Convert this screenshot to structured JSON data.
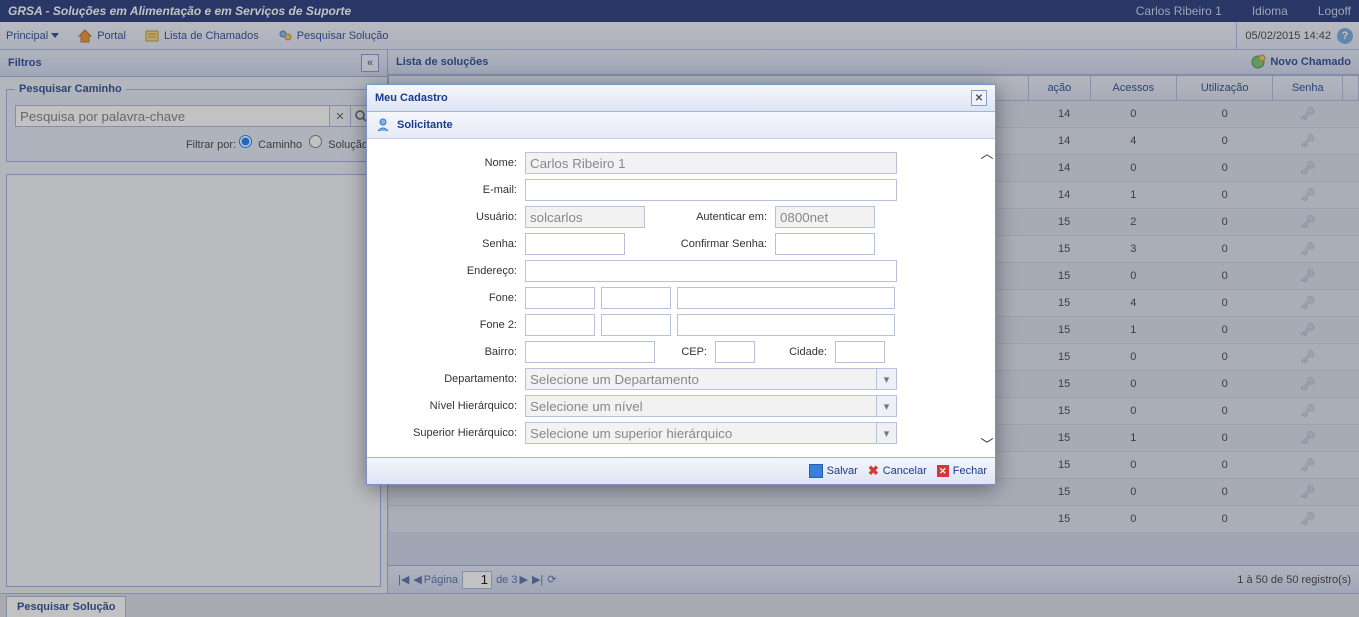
{
  "topbar": {
    "title": "GRSA - Soluções em Alimentação e em Serviços de Suporte",
    "user": "Carlos Ribeiro 1",
    "lang": "Idioma",
    "logoff": "Logoff"
  },
  "toolbar": {
    "principal": "Principal",
    "portal": "Portal",
    "lista": "Lista de Chamados",
    "pesquisar": "Pesquisar Solução",
    "datetime": "05/02/2015 14:42"
  },
  "left": {
    "title": "Filtros",
    "fieldset_title": "Pesquisar Caminho",
    "search_placeholder": "Pesquisa por palavra-chave",
    "filter_label": "Filtrar por:",
    "opt_caminho": "Caminho",
    "opt_solucao": "Solução"
  },
  "right": {
    "title": "Lista de soluções",
    "novo": "Novo Chamado",
    "cols": {
      "acao": "ação",
      "acessos": "Acessos",
      "util": "Utilização",
      "senha": "Senha"
    },
    "rows": [
      {
        "d": "14",
        "a": "0",
        "u": "0"
      },
      {
        "d": "14",
        "a": "4",
        "u": "0"
      },
      {
        "d": "14",
        "a": "0",
        "u": "0"
      },
      {
        "d": "14",
        "a": "1",
        "u": "0"
      },
      {
        "d": "15",
        "a": "2",
        "u": "0"
      },
      {
        "d": "15",
        "a": "3",
        "u": "0"
      },
      {
        "d": "15",
        "a": "0",
        "u": "0"
      },
      {
        "d": "15",
        "a": "4",
        "u": "0"
      },
      {
        "d": "15",
        "a": "1",
        "u": "0"
      },
      {
        "d": "15",
        "a": "0",
        "u": "0"
      },
      {
        "d": "15",
        "a": "0",
        "u": "0"
      },
      {
        "d": "15",
        "a": "0",
        "u": "0"
      },
      {
        "d": "15",
        "a": "1",
        "u": "0"
      },
      {
        "d": "15",
        "a": "0",
        "u": "0"
      },
      {
        "d": "15",
        "a": "0",
        "u": "0"
      },
      {
        "d": "15",
        "a": "0",
        "u": "0"
      }
    ],
    "paging": {
      "label": "Página",
      "num": "1",
      "of": "de 3",
      "summary": "1 à 50 de 50 registro(s)"
    }
  },
  "modal": {
    "title": "Meu Cadastro",
    "section": "Solicitante",
    "labels": {
      "nome": "Nome:",
      "email": "E-mail:",
      "usuario": "Usuário:",
      "auth": "Autenticar em:",
      "senha": "Senha:",
      "conf": "Confirmar Senha:",
      "endereco": "Endereço:",
      "fone": "Fone:",
      "fone2": "Fone 2:",
      "bairro": "Bairro:",
      "cep": "CEP:",
      "cidade": "Cidade:",
      "dept": "Departamento:",
      "nivel": "Nível Hierárquico:",
      "superior": "Superior Hierárquico:"
    },
    "values": {
      "nome": "Carlos Ribeiro 1",
      "usuario": "solcarlos",
      "auth": "0800net",
      "dept_ph": "Selecione um Departamento",
      "nivel_ph": "Selecione um nível",
      "superior_ph": "Selecione um superior hierárquico"
    },
    "buttons": {
      "salvar": "Salvar",
      "cancelar": "Cancelar",
      "fechar": "Fechar"
    }
  },
  "footer": {
    "tab": "Pesquisar Solução"
  }
}
